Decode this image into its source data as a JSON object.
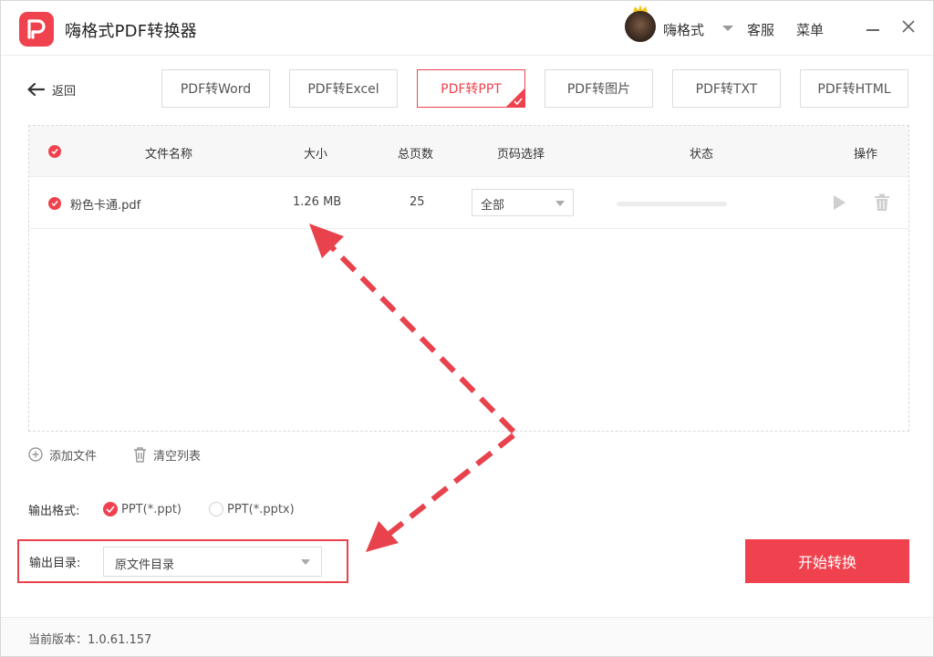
{
  "app": {
    "title": "嗨格式PDF转换器",
    "username": "嗨格式",
    "service_label": "客服",
    "menu_label": "菜单"
  },
  "toolbar": {
    "back_label": "返回",
    "tabs": [
      {
        "label": "PDF转Word",
        "active": false
      },
      {
        "label": "PDF转Excel",
        "active": false
      },
      {
        "label": "PDF转PPT",
        "active": true
      },
      {
        "label": "PDF转图片",
        "active": false
      },
      {
        "label": "PDF转TXT",
        "active": false
      },
      {
        "label": "PDF转HTML",
        "active": false
      }
    ]
  },
  "table": {
    "headers": {
      "name": "文件名称",
      "size": "大小",
      "pages": "总页数",
      "page_select": "页码选择",
      "status": "状态",
      "actions": "操作"
    },
    "rows": [
      {
        "name": "粉色卡通.pdf",
        "size": "1.26 MB",
        "pages": "25",
        "page_select": "全部",
        "progress": 0
      }
    ]
  },
  "actions": {
    "add_file": "添加文件",
    "clear_list": "清空列表"
  },
  "output_format": {
    "label": "输出格式:",
    "options": [
      {
        "label": "PPT(*.ppt)",
        "selected": true
      },
      {
        "label": "PPT(*.pptx)",
        "selected": false
      }
    ]
  },
  "output_dir": {
    "label": "输出目录:",
    "value": "原文件目录"
  },
  "start_button": "开始转换",
  "footer": {
    "version": "当前版本：1.0.61.157"
  },
  "colors": {
    "accent": "#f0424e",
    "annotation": "#e8424c"
  }
}
